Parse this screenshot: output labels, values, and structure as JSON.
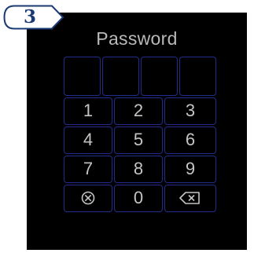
{
  "badge": {
    "number": "3"
  },
  "screen": {
    "title": "Password"
  },
  "password_slots": [
    "",
    "",
    "",
    ""
  ],
  "keypad": {
    "row1": [
      "1",
      "2",
      "3"
    ],
    "row2": [
      "4",
      "5",
      "6"
    ],
    "row3": [
      "7",
      "8",
      "9"
    ],
    "row4": {
      "clear_icon": "circled-x-icon",
      "zero": "0",
      "backspace_icon": "backspace-icon"
    }
  },
  "colors": {
    "badge_stroke": "#1a3a73",
    "screen_bg": "#000000",
    "key_border": "#232c8c",
    "key_text": "#c4c4c4",
    "title_text": "#b9b9b9"
  }
}
